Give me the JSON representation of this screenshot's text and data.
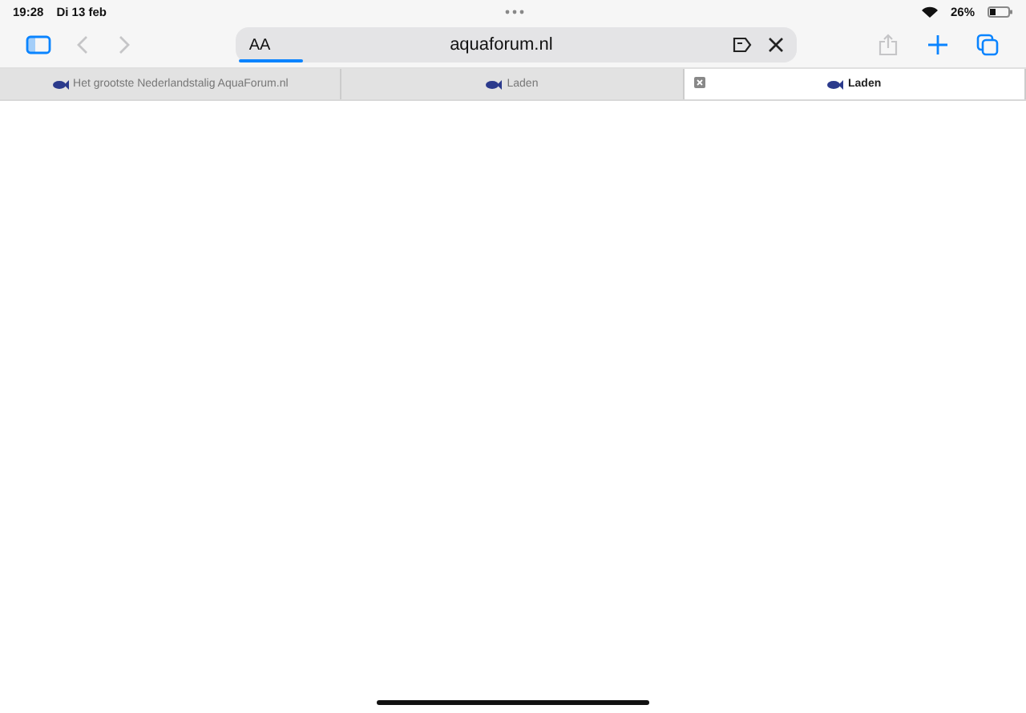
{
  "status_bar": {
    "time": "19:28",
    "date": "Di 13 feb",
    "battery": "26%"
  },
  "toolbar": {
    "back_disabled": true,
    "forward_disabled": true,
    "share_disabled": true
  },
  "address_bar": {
    "text_size": "AA",
    "url": "aquaforum.nl",
    "progress": {
      "level": 0.11
    }
  },
  "tabs": [
    {
      "title": "Het grootste Nederlandstalig AquaForum.nl",
      "selected": false
    },
    {
      "title": "Laden",
      "selected": false
    },
    {
      "title": "Laden",
      "selected": true
    }
  ]
}
